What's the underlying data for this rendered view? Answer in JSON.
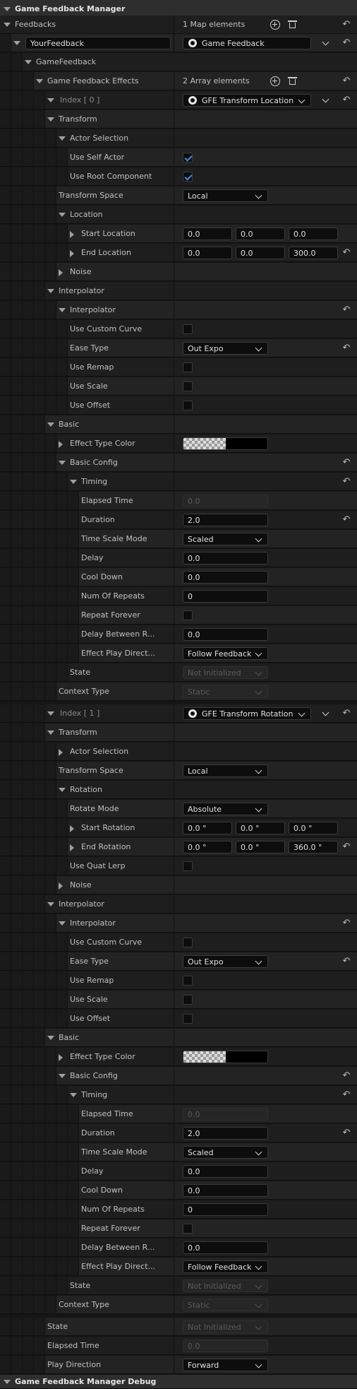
{
  "header": {
    "title": "Game Feedback Manager"
  },
  "feedbacks": {
    "label": "Feedbacks",
    "count": "1 Map elements"
  },
  "map_entry": {
    "key": "YourFeedback",
    "value": "Game Feedback"
  },
  "game_feedback": {
    "label": "GameFeedback"
  },
  "effects": {
    "label": "Game Feedback Effects",
    "count": "2 Array elements"
  },
  "index0": {
    "index_label": "Index [ 0 ]",
    "asset": "GFE Transform Location",
    "transform": "Transform",
    "actor_selection": "Actor Selection",
    "use_self_actor": "Use Self Actor",
    "use_root_component": "Use Root Component",
    "transform_space_label": "Transform Space",
    "transform_space": "Local",
    "location": "Location",
    "start_location": "Start Location",
    "start_x": "0.0",
    "start_y": "0.0",
    "start_z": "0.0",
    "end_location": "End Location",
    "end_x": "0.0",
    "end_y": "0.0",
    "end_z": "300.0",
    "noise": "Noise",
    "interpolator_group": "Interpolator",
    "interpolator": "Interpolator",
    "use_custom_curve": "Use Custom Curve",
    "ease_type_label": "Ease Type",
    "ease_type": "Out Expo",
    "use_remap": "Use Remap",
    "use_scale": "Use Scale",
    "use_offset": "Use Offset",
    "basic": "Basic",
    "effect_type_color": "Effect Type Color",
    "basic_config": "Basic Config",
    "timing": "Timing",
    "elapsed_time_label": "Elapsed Time",
    "elapsed_time": "0.0",
    "duration_label": "Duration",
    "duration": "2.0",
    "time_scale_mode_label": "Time Scale Mode",
    "time_scale_mode": "Scaled",
    "delay_label": "Delay",
    "delay": "0.0",
    "cool_down_label": "Cool Down",
    "cool_down": "0.0",
    "num_repeats_label": "Num Of Repeats",
    "num_repeats": "0",
    "repeat_forever_label": "Repeat Forever",
    "delay_between_label": "Delay Between R...",
    "delay_between": "0.0",
    "effect_play_label": "Effect Play Direct...",
    "effect_play": "Follow Feedback",
    "state_label": "State",
    "state": "Not Initialized",
    "context_type_label": "Context Type",
    "context_type": "Static"
  },
  "index1": {
    "index_label": "Index [ 1 ]",
    "asset": "GFE Transform Rotation",
    "transform": "Transform",
    "actor_selection": "Actor Selection",
    "transform_space_label": "Transform Space",
    "transform_space": "Local",
    "rotation": "Rotation",
    "rotate_mode_label": "Rotate Mode",
    "rotate_mode": "Absolute",
    "start_rotation": "Start Rotation",
    "start_x": "0.0 °",
    "start_y": "0.0 °",
    "start_z": "0.0 °",
    "end_rotation": "End Rotation",
    "end_x": "0.0 °",
    "end_y": "0.0 °",
    "end_z": "360.0 °",
    "use_quat_lerp": "Use Quat Lerp",
    "noise": "Noise",
    "interpolator_group": "Interpolator",
    "interpolator": "Interpolator",
    "use_custom_curve": "Use Custom Curve",
    "ease_type_label": "Ease Type",
    "ease_type": "Out Expo",
    "use_remap": "Use Remap",
    "use_scale": "Use Scale",
    "use_offset": "Use Offset",
    "basic": "Basic",
    "effect_type_color": "Effect Type Color",
    "basic_config": "Basic Config",
    "timing": "Timing",
    "elapsed_time_label": "Elapsed Time",
    "elapsed_time": "0.0",
    "duration_label": "Duration",
    "duration": "2.0",
    "time_scale_mode_label": "Time Scale Mode",
    "time_scale_mode": "Scaled",
    "delay_label": "Delay",
    "delay": "0.0",
    "cool_down_label": "Cool Down",
    "cool_down": "0.0",
    "num_repeats_label": "Num Of Repeats",
    "num_repeats": "0",
    "repeat_forever_label": "Repeat Forever",
    "delay_between_label": "Delay Between R...",
    "delay_between": "0.0",
    "effect_play_label": "Effect Play Direct...",
    "effect_play": "Follow Feedback",
    "state_label": "State",
    "state": "Not Initialized",
    "context_type_label": "Context Type",
    "context_type": "Static"
  },
  "manager": {
    "state_label": "State",
    "state": "Not Initialized",
    "elapsed_time_label": "Elapsed Time",
    "elapsed_time": "0.0",
    "play_direction_label": "Play Direction",
    "play_direction": "Forward"
  },
  "debug_header": {
    "title": "Game Feedback Manager Debug"
  },
  "colors": {
    "accent_check": "#3b8cf0",
    "background": "#151515",
    "row": "#1e1e1e",
    "header": "#2e2e2e"
  },
  "icons": [
    "reset-arrow-icon",
    "add-circle-icon",
    "trash-icon",
    "chevron-down-icon",
    "asset-icon",
    "checkmark-icon"
  ]
}
